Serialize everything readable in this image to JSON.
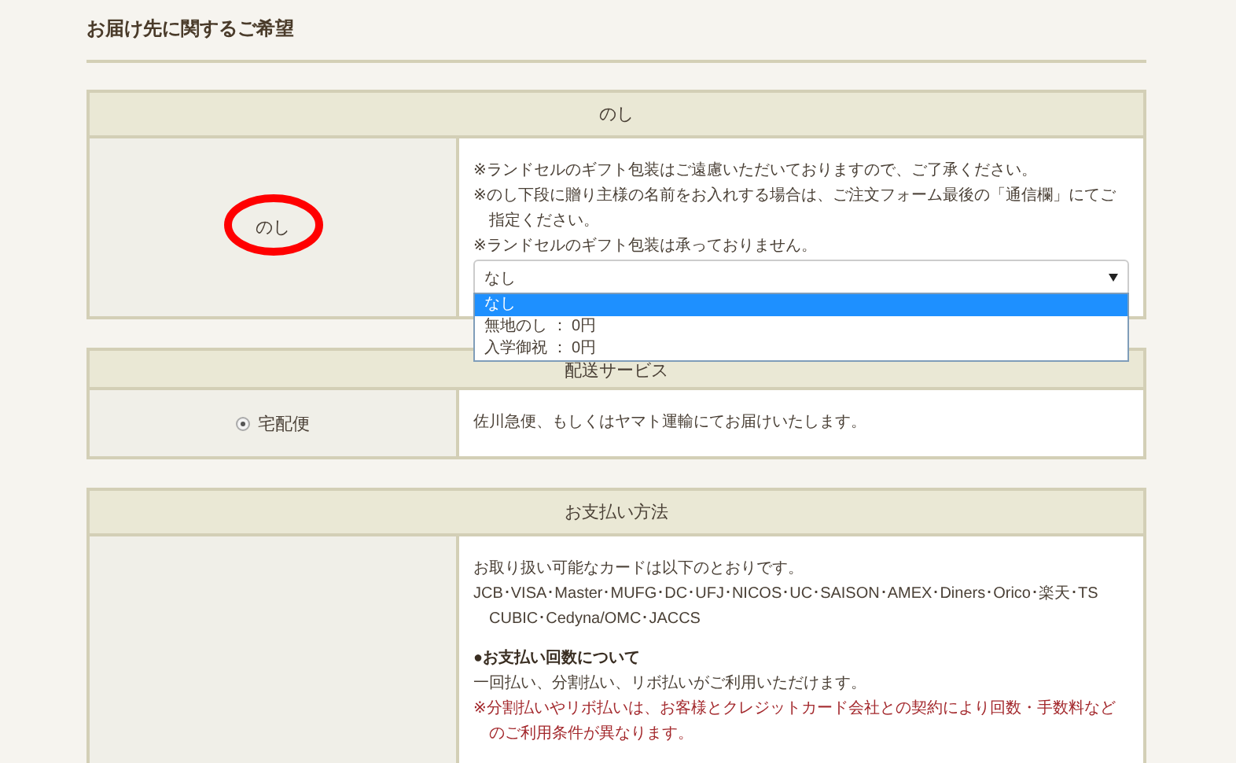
{
  "page_title": "お届け先に関するご希望",
  "sections": [
    {
      "title": "のし",
      "label": {
        "kind": "text",
        "text": "のし",
        "circled": true
      },
      "content": [
        {
          "kind": "text",
          "text": "※ランドセルのギフト包装はご遠慮いただいておりますので、ご了承ください。"
        },
        {
          "kind": "text",
          "text": "※のし下段に贈り主様の名前をお入れする場合は、ご注文フォーム最後の「通信欄」にてご指定ください。"
        },
        {
          "kind": "text",
          "text": "※ランドセルのギフト包装は承っておりません。"
        },
        {
          "kind": "select",
          "value": "なし",
          "expanded": true,
          "options": [
            {
              "label": "なし",
              "selected": true
            },
            {
              "label": "無地のし ： 0円",
              "selected": false
            },
            {
              "label": "入学御祝 ： 0円",
              "selected": false
            }
          ]
        }
      ]
    },
    {
      "title": "配送サービス",
      "label": {
        "kind": "radio",
        "text": "宅配便",
        "checked": true
      },
      "content": [
        {
          "kind": "text",
          "text": "佐川急便、もしくはヤマト運輸にてお届けいたします。"
        }
      ]
    },
    {
      "title": "お支払い方法",
      "content": [
        {
          "kind": "text",
          "text": "お取り扱い可能なカードは以下のとおりです。"
        },
        {
          "kind": "text",
          "text": "JCB･VISA･Master･MUFG･DC･UFJ･NICOS･UC･SAISON･AMEX･Diners･Orico･楽天･TS CUBIC･Cedyna/OMC･JACCS"
        },
        {
          "kind": "heading",
          "text": "●お支払い回数について"
        },
        {
          "kind": "text",
          "text": "一回払い、分割払い、リボ払いがご利用いただけます。"
        },
        {
          "kind": "note",
          "text": "※分割払いやリボ払いは、お客様とクレジットカード会社との契約により回数・手数料などのご利用条件が異なります。"
        }
      ]
    }
  ]
}
